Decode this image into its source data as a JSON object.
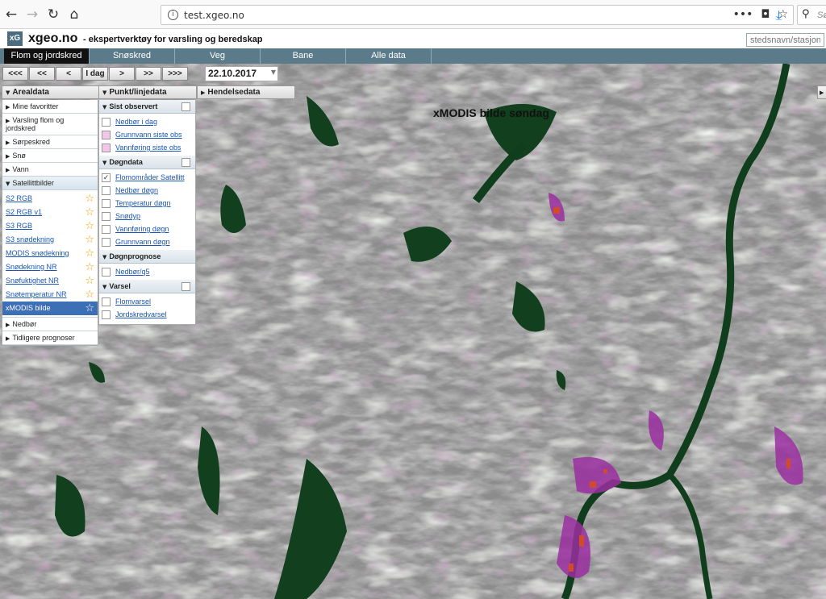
{
  "browser": {
    "url": "test.xgeo.no",
    "search_placeholder": "Sø"
  },
  "app": {
    "logo": "xG",
    "brand": "xgeo.no",
    "tagline": "- ekspertverktøy for varsling og beredskap",
    "place_search_placeholder": "stedsnavn/stasjon"
  },
  "main_tabs": [
    {
      "label": "Flom og jordskred",
      "active": true
    },
    {
      "label": "Snøskred",
      "active": false
    },
    {
      "label": "Veg",
      "active": false
    },
    {
      "label": "Bane",
      "active": false
    },
    {
      "label": "Alle data",
      "active": false
    }
  ],
  "date_nav": {
    "buttons": [
      "<<<",
      "<<",
      "<",
      "I dag",
      ">",
      ">>",
      ">>>"
    ],
    "date": "22.10.2017"
  },
  "panels": {
    "areal": {
      "title": "Arealdata",
      "items_top": [
        "Mine favoritter",
        "Varsling flom og jordskred",
        "Sørpeskred",
        "Snø",
        "Vann"
      ],
      "open_section": "Satellittbilder",
      "links": [
        "S2 RGB",
        "S2 RGB v1",
        "S3 RGB",
        "S3 snødekning",
        "MODIS snødekning",
        "Snødekning NR",
        "Snøfuktighet NR",
        "Snøtemperatur NR",
        "xMODIS bilde"
      ],
      "selected_link": "xMODIS bilde",
      "items_bottom": [
        "Nedbør",
        "Tidligere prognoser"
      ]
    },
    "punkt": {
      "title": "Punkt/linjedata",
      "groups": [
        {
          "title": "Sist observert",
          "rows": [
            {
              "label": "Nedbør i dag",
              "checked": false,
              "pink": false
            },
            {
              "label": "Grunnvann siste obs",
              "checked": false,
              "pink": true
            },
            {
              "label": "Vannføring siste obs",
              "checked": false,
              "pink": true
            }
          ]
        },
        {
          "title": "Døgndata",
          "rows": [
            {
              "label": "Flomområder Satellitt",
              "checked": true,
              "pink": false
            },
            {
              "label": "Nedbør døgn",
              "checked": false,
              "pink": false
            },
            {
              "label": "Temperatur døgn",
              "checked": false,
              "pink": false
            },
            {
              "label": "Snødyp",
              "checked": false,
              "pink": false
            },
            {
              "label": "Vannføring døgn",
              "checked": false,
              "pink": false
            },
            {
              "label": "Grunnvann døgn",
              "checked": false,
              "pink": false
            }
          ]
        },
        {
          "title": "Døgnprognose",
          "rows": [
            {
              "label": "Nedbør/q5",
              "checked": false,
              "pink": false
            }
          ]
        },
        {
          "title": "Varsel",
          "rows": [
            {
              "label": "Flomvarsel",
              "checked": false,
              "pink": false
            },
            {
              "label": "Jordskredvarsel",
              "checked": false,
              "pink": false
            }
          ]
        }
      ]
    },
    "hendelse": {
      "title": "Hendelsedata"
    }
  },
  "map": {
    "title": "xMODIS bilde søndag",
    "colors": {
      "base": "#8c8c8c",
      "water": "#0d3d1a",
      "flood": "#9a2fa0",
      "flood_marker": "#d14a2a",
      "light": "#e3e8e0"
    }
  }
}
